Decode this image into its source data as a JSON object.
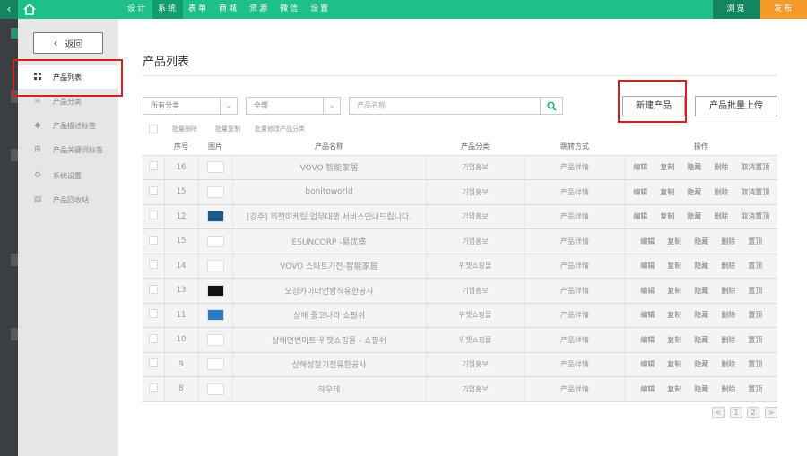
{
  "topbar": {
    "back_icon": "chevron-left-icon",
    "home_icon": "home-icon",
    "nav": [
      {
        "label": "设计",
        "active": false
      },
      {
        "label": "系统",
        "active": true
      },
      {
        "label": "表单",
        "active": false
      },
      {
        "label": "商城",
        "active": false
      },
      {
        "label": "资源",
        "active": false
      },
      {
        "label": "微信",
        "active": false
      },
      {
        "label": "设置",
        "active": false
      }
    ],
    "preview_label": "浏览",
    "publish_label": "发布",
    "colors": {
      "bar": "#1fbf88",
      "active": "#149d6e",
      "preview": "#14865f",
      "publish": "#f39a2b"
    }
  },
  "sidebar": {
    "back_label": "返回",
    "items": [
      {
        "label": "产品列表",
        "icon": "grid-icon",
        "active": true
      },
      {
        "label": "产品分类",
        "icon": "list-icon",
        "active": false
      },
      {
        "label": "产品描述标签",
        "icon": "tag-icon",
        "active": false
      },
      {
        "label": "产品关键词标签",
        "icon": "plus-square-icon",
        "active": false
      },
      {
        "label": "系统设置",
        "icon": "gear-icon",
        "active": false
      },
      {
        "label": "产品回收站",
        "icon": "trash-icon",
        "active": false
      }
    ]
  },
  "main": {
    "title": "产品列表",
    "filters": {
      "category_select": "所有分类",
      "status_select": "全部",
      "search_placeholder": "产品名称"
    },
    "buttons": {
      "new_product": "新建产品",
      "bulk_upload": "产品批量上传"
    },
    "bulk_actions": [
      "批量删除",
      "批量复制",
      "批量修改产品分类"
    ],
    "table": {
      "headers": [
        "序号",
        "图片",
        "产品名称",
        "产品分类",
        "跳转方式",
        "操作"
      ],
      "rows": [
        {
          "no": "16",
          "name": "VOVO 智能家居",
          "category": "기업홍보",
          "jump": "产品详情",
          "ops": [
            "编辑",
            "复制",
            "隐藏",
            "删除",
            "取消置顶"
          ]
        },
        {
          "no": "15",
          "name": "bonitoworld",
          "category": "기업홍보",
          "jump": "产品详情",
          "ops": [
            "编辑",
            "复制",
            "隐藏",
            "删除",
            "取消置顶"
          ]
        },
        {
          "no": "12",
          "name": "[강주] 위챗마케팅 업무대행 서비스안내드립니다.",
          "category": "기업홍보",
          "jump": "产品详情",
          "ops": [
            "编辑",
            "复制",
            "隐藏",
            "删除",
            "取消置顶"
          ]
        },
        {
          "no": "15",
          "name": "ESUNCORP -易优盛",
          "category": "기업홍보",
          "jump": "产品详情",
          "ops": [
            "编辑",
            "复制",
            "隐藏",
            "删除",
            "置顶"
          ]
        },
        {
          "no": "14",
          "name": "VOVO 스타트가전-智能家居",
          "category": "위챗쇼핑몰",
          "jump": "产品详情",
          "ops": [
            "编辑",
            "复制",
            "隐藏",
            "删除",
            "置顶"
          ]
        },
        {
          "no": "13",
          "name": "오강카이더언방직유한공사",
          "category": "기업홍보",
          "jump": "产品详情",
          "ops": [
            "编辑",
            "复制",
            "隐藏",
            "删除",
            "置顶"
          ]
        },
        {
          "no": "11",
          "name": "상해 중고나라 쇼핑쉬",
          "category": "위챗쇼핑몰",
          "jump": "产品详情",
          "ops": [
            "编辑",
            "复制",
            "隐藏",
            "删除",
            "置顶"
          ]
        },
        {
          "no": "10",
          "name": "상해연변마트 위챗쇼핑몰 - 쇼핑쉬",
          "category": "위챗쇼핑몰",
          "jump": "产品详情",
          "ops": [
            "编辑",
            "复制",
            "隐藏",
            "删除",
            "置顶"
          ]
        },
        {
          "no": "9",
          "name": "상해성철기전유한공사",
          "category": "기업홍보",
          "jump": "产品详情",
          "ops": [
            "编辑",
            "复制",
            "隐藏",
            "删除",
            "置顶"
          ]
        },
        {
          "no": "8",
          "name": "하우테",
          "category": "기업홍보",
          "jump": "产品详情",
          "ops": [
            "编辑",
            "复制",
            "隐藏",
            "删除",
            "置顶"
          ]
        }
      ]
    },
    "pagination": {
      "prev": "<",
      "pages": [
        "1",
        "2"
      ],
      "next": ">"
    }
  }
}
